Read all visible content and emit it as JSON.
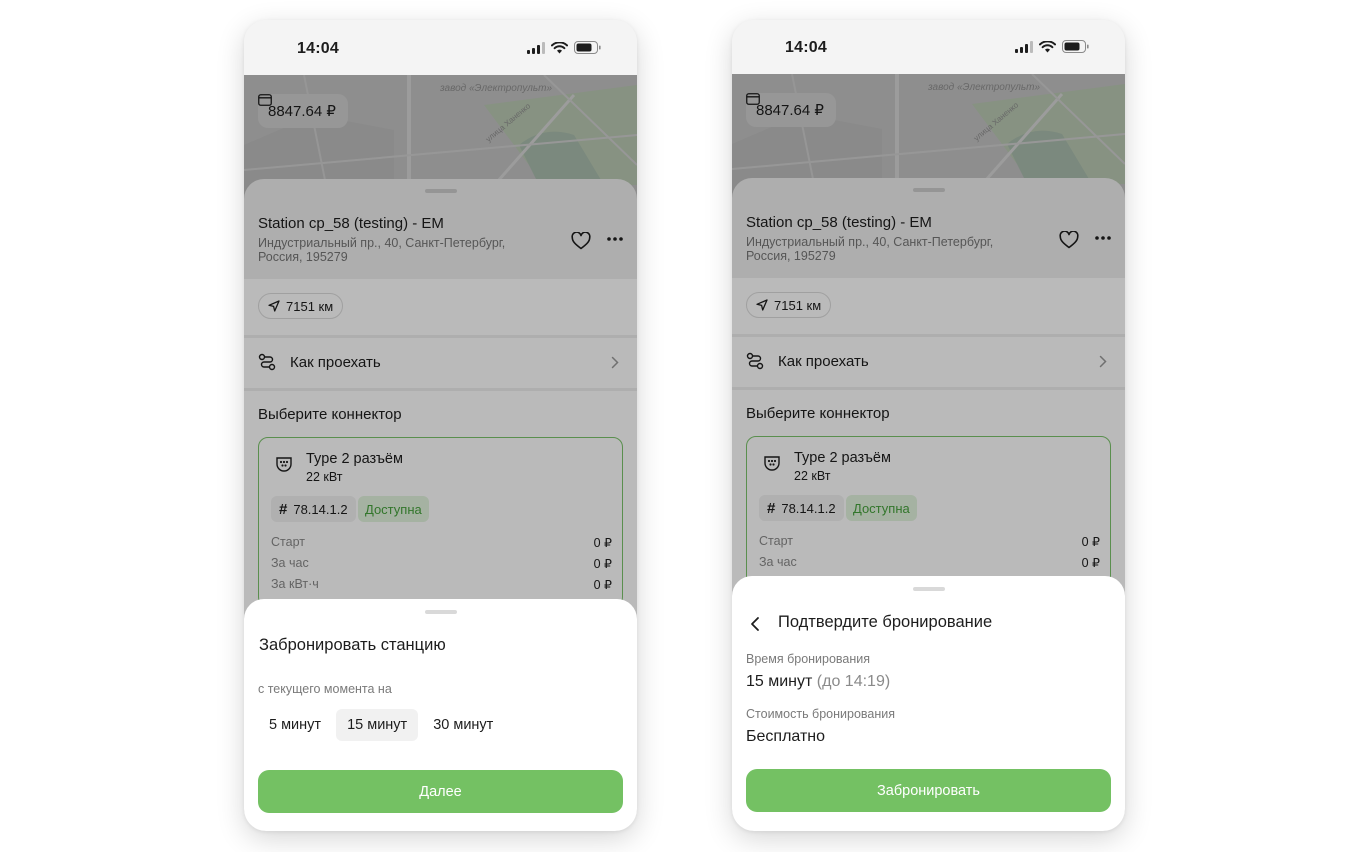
{
  "status_time": "14:04",
  "balance": "8847.64 ₽",
  "map_labels": {
    "area": "завод «Электропульт»",
    "street": "улица Ханенко"
  },
  "station": {
    "name": "Station cp_58 (testing) - EM",
    "address": "Индустриальный пр., 40, Санкт-Петербург, Россия, 195279",
    "distance": "7151 км",
    "directions_label": "Как проехать",
    "connector_section_title": "Выберите коннектор"
  },
  "connector": {
    "name": "Type 2 разъём",
    "power": "22 кВт",
    "id": "78.14.1.2",
    "status": "Доступна",
    "prices": [
      {
        "label": "Старт",
        "value": "0 ₽"
      },
      {
        "label": "За час",
        "value": "0 ₽"
      },
      {
        "label": "За кВт·ч",
        "value": "0 ₽"
      }
    ]
  },
  "booking": {
    "title": "Забронировать станцию",
    "subtitle": "с текущего момента на",
    "options": [
      "5 минут",
      "15 минут",
      "30 минут"
    ],
    "selected_option": "15 минут",
    "next_button": "Далее"
  },
  "confirm": {
    "title": "Подтвердите бронирование",
    "time_label": "Время бронирования",
    "time_value": "15 минут",
    "time_until": "(до 14:19)",
    "cost_label": "Стоимость бронирования",
    "cost_value": "Бесплатно",
    "book_button": "Забронировать"
  },
  "colors": {
    "accent_green": "#74c163",
    "status_green_text": "#45a23b",
    "status_green_bg": "#e3f4df",
    "connector_border": "#7cc46c"
  }
}
